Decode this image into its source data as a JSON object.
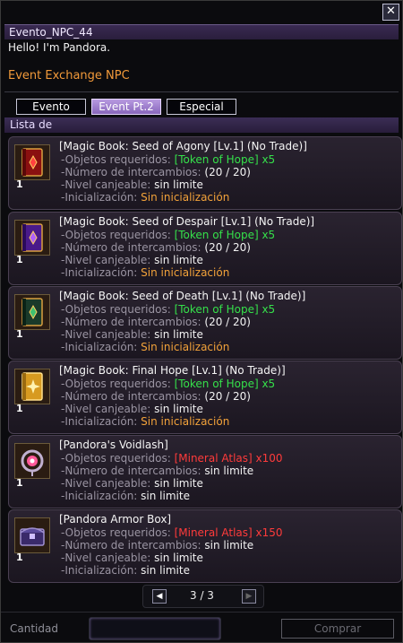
{
  "window": {
    "title": "Evento_NPC_44"
  },
  "npc": {
    "greeting": "Hello! I'm Pandora.",
    "role": "Event Exchange NPC"
  },
  "tabs": [
    "Evento",
    "Event Pt.2",
    "Especial"
  ],
  "section": {
    "title": "Lista de"
  },
  "labels": {
    "required": "-Objetos requeridos:",
    "exchanges": "-Número de intercambios:",
    "level": "-Nivel canjeable:",
    "reset": "-Inicialización:"
  },
  "items": [
    {
      "name": "[Magic Book: Seed of Agony [Lv.1] (No Trade)]",
      "icon": "red-book-icon",
      "qty": "1",
      "required": "[Token of Hope] x5",
      "required_color": "green",
      "exchanges": "(20 / 20)",
      "level": "sin limite",
      "reset": "Sin inicialización"
    },
    {
      "name": "[Magic Book: Seed of Despair [Lv.1] (No Trade)]",
      "icon": "purple-book-icon",
      "qty": "1",
      "required": "[Token of Hope] x5",
      "required_color": "green",
      "exchanges": "(20 / 20)",
      "level": "sin limite",
      "reset": "Sin inicialización"
    },
    {
      "name": "[Magic Book: Seed of Death [Lv.1] (No Trade)]",
      "icon": "green-book-icon",
      "qty": "1",
      "required": "[Token of Hope] x5",
      "required_color": "green",
      "exchanges": "(20 / 20)",
      "level": "sin limite",
      "reset": "Sin inicialización"
    },
    {
      "name": "[Magic Book: Final Hope [Lv.1] (No Trade)]",
      "icon": "gold-book-icon",
      "qty": "1",
      "required": "[Token of Hope] x5",
      "required_color": "green",
      "exchanges": "(20 / 20)",
      "level": "sin limite",
      "reset": "Sin inicialización"
    },
    {
      "name": "[Pandora's Voidlash]",
      "icon": "voidlash-orb-icon",
      "qty": "1",
      "required": "[Mineral Atlas] x100",
      "required_color": "red",
      "exchanges": "sin limite",
      "level": "sin limite",
      "reset": "sin limite"
    },
    {
      "name": "[Pandora Armor Box]",
      "icon": "armor-chest-icon",
      "qty": "1",
      "required": "[Mineral Atlas] x150",
      "required_color": "red",
      "exchanges": "sin limite",
      "level": "sin limite",
      "reset": "sin limite"
    }
  ],
  "pager": {
    "text": "3 / 3"
  },
  "footer": {
    "quantity_label": "Cantidad",
    "buy_label": "Comprar"
  },
  "colors": {
    "accent_purple": "#8866bb",
    "green": "#35e04a",
    "red": "#ff3b3b",
    "orange": "#f2a23a"
  }
}
